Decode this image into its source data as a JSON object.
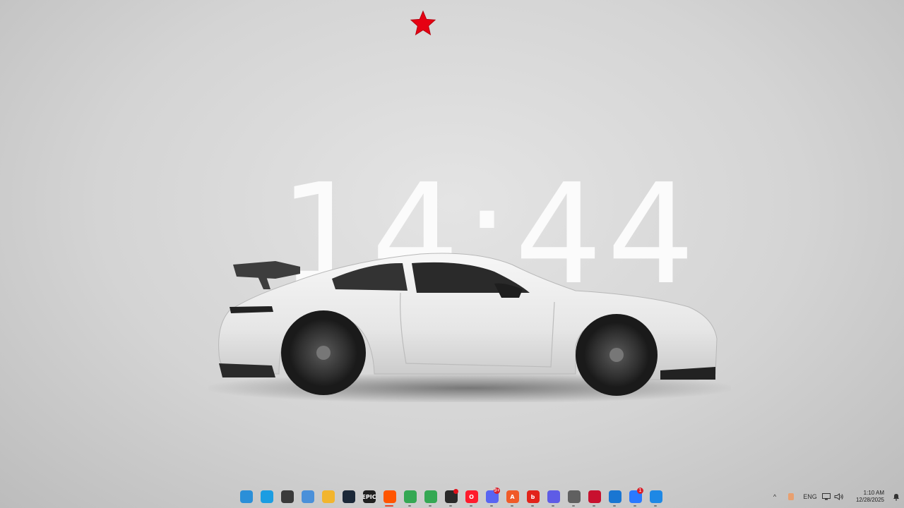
{
  "desktop": {
    "clock": "14:44"
  },
  "taskbar": {
    "apps": [
      {
        "name": "start",
        "label": "",
        "color": "#2b8fd8"
      },
      {
        "name": "edge",
        "label": "",
        "color": "#1b9de2"
      },
      {
        "name": "obs",
        "label": "",
        "color": "#3a3a3a"
      },
      {
        "name": "microsoft-store",
        "label": "",
        "color": "#4a90d9"
      },
      {
        "name": "file-explorer",
        "label": "",
        "color": "#f2b52e"
      },
      {
        "name": "steam",
        "label": "",
        "color": "#1b2838"
      },
      {
        "name": "epic-games",
        "label": "EPIC",
        "color": "#202020"
      },
      {
        "name": "soundcloud",
        "label": "",
        "color": "#ff5500"
      },
      {
        "name": "chrome",
        "label": "",
        "color": "#34a853"
      },
      {
        "name": "chrome-profile",
        "label": "",
        "color": "#34a853"
      },
      {
        "name": "davinci-resolve",
        "label": "",
        "color": "#2a2a2a"
      },
      {
        "name": "opera",
        "label": "O",
        "color": "#ff1b2d"
      },
      {
        "name": "discord",
        "label": "",
        "color": "#5865f2",
        "badge": "9+"
      },
      {
        "name": "arc-app",
        "label": "A",
        "color": "#f05a28"
      },
      {
        "name": "bitdefender",
        "label": "b",
        "color": "#e2231a"
      },
      {
        "name": "linear",
        "label": "",
        "color": "#5e5ce6"
      },
      {
        "name": "network-tool",
        "label": "",
        "color": "#606060"
      },
      {
        "name": "red-app",
        "label": "",
        "color": "#c8102e"
      },
      {
        "name": "blue-app",
        "label": "",
        "color": "#1976d2"
      },
      {
        "name": "rocket-app",
        "label": "",
        "color": "#2979ff",
        "badge": "1"
      },
      {
        "name": "blue-shield-app",
        "label": "",
        "color": "#1e88e5"
      }
    ],
    "tray": {
      "chevron": "^",
      "language": "ENG",
      "time": "1:10 AM",
      "date": "12/28/2025"
    }
  },
  "colors": {
    "star": "#e60012",
    "clock_text": "#fbfbfb",
    "active_indicator": "#e8452a"
  }
}
